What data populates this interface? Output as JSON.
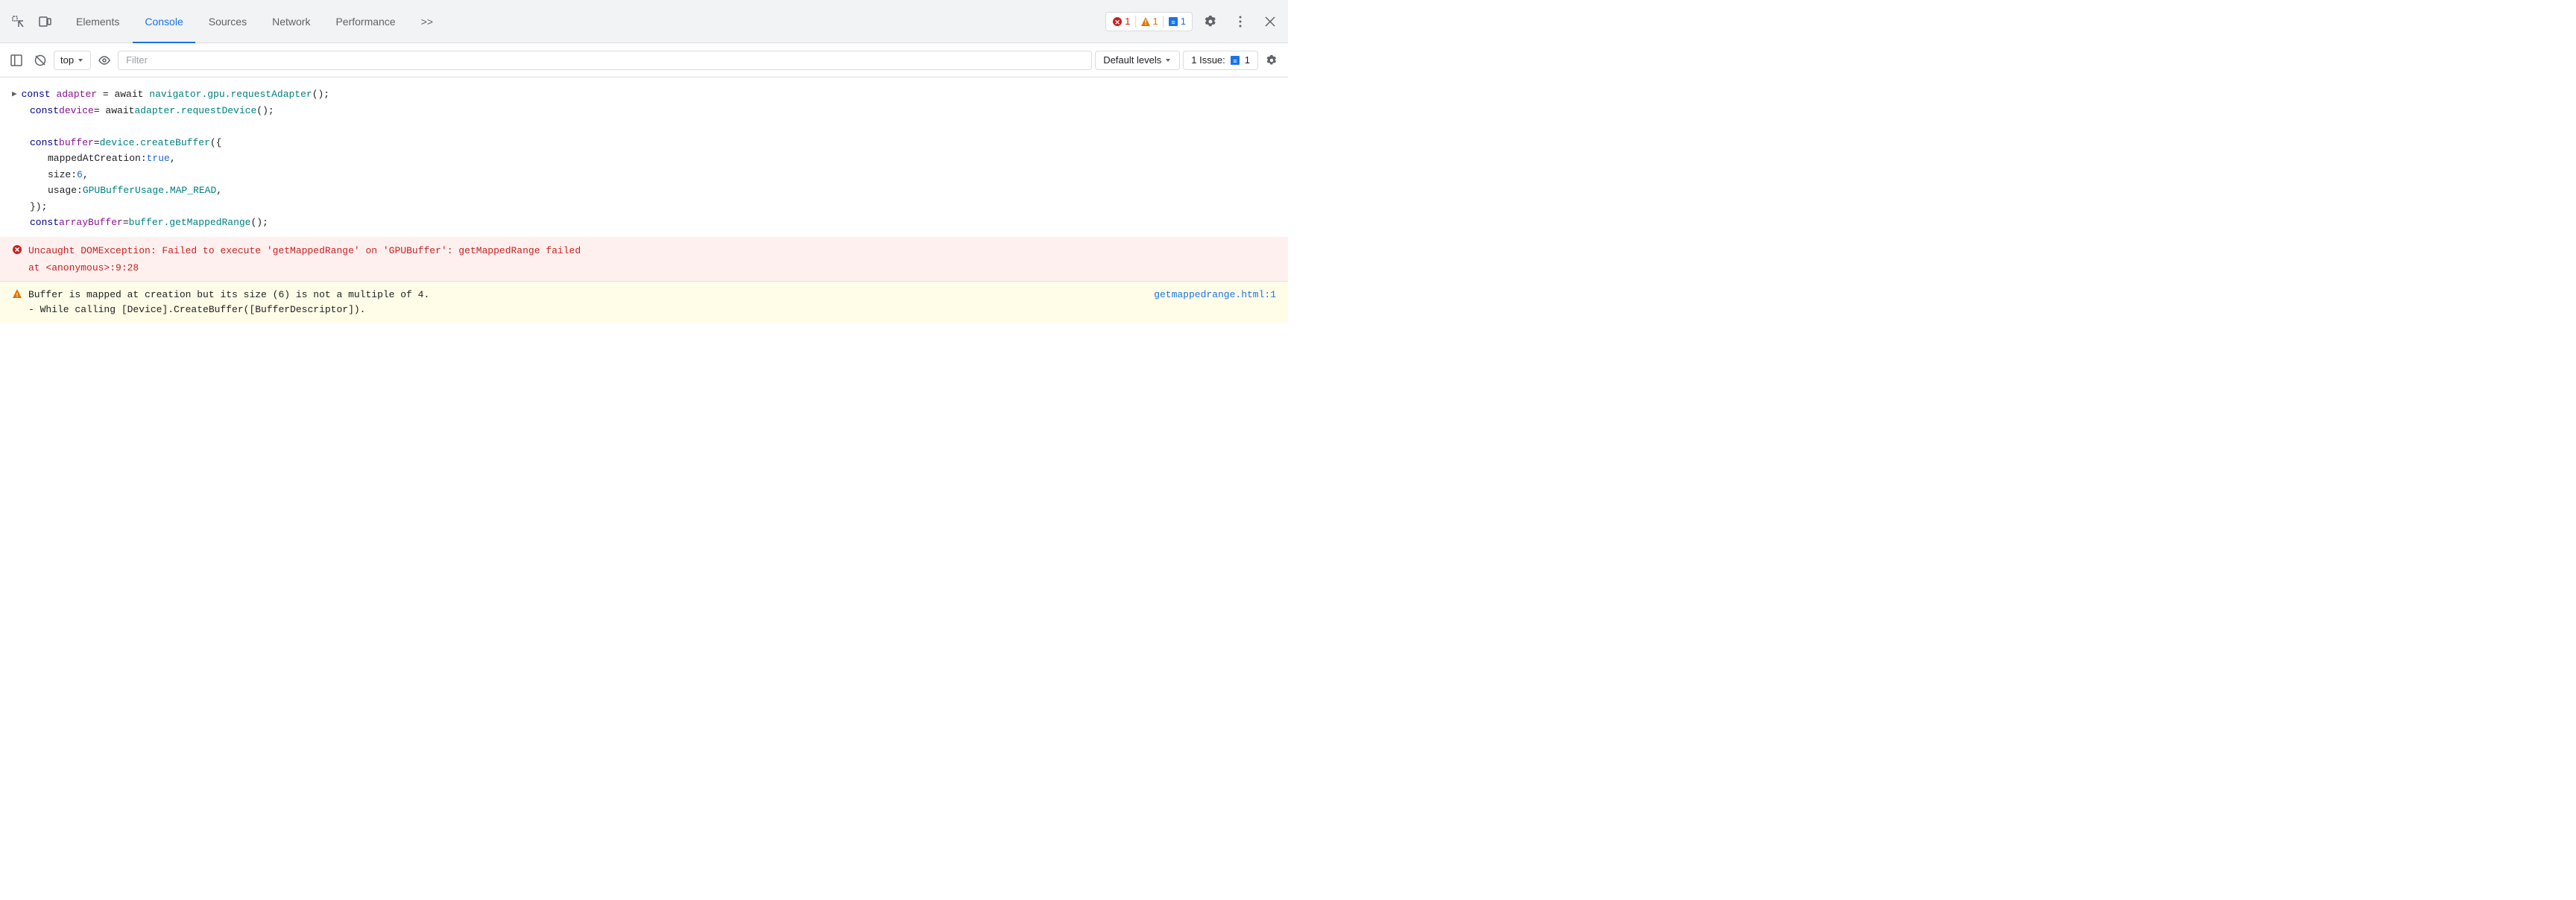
{
  "tabs": {
    "items": [
      {
        "id": "elements",
        "label": "Elements",
        "active": false
      },
      {
        "id": "console",
        "label": "Console",
        "active": true
      },
      {
        "id": "sources",
        "label": "Sources",
        "active": false
      },
      {
        "id": "network",
        "label": "Network",
        "active": false
      },
      {
        "id": "performance",
        "label": "Performance",
        "active": false
      },
      {
        "id": "more",
        "label": ">>",
        "active": false
      }
    ]
  },
  "badges": {
    "error_count": "1",
    "warning_count": "1",
    "info_count": "1"
  },
  "toolbar": {
    "context": "top",
    "filter_placeholder": "Filter",
    "levels_label": "Default levels",
    "issue_label": "1 Issue:",
    "issue_count": "1"
  },
  "code": {
    "line1_prefix": "const ",
    "line1_var": "adapter",
    "line1_eq": " = await ",
    "line1_call": "navigator.gpu.requestAdapter",
    "line1_suffix": "();",
    "line2_prefix": "const ",
    "line2_var": "device",
    "line2_eq": " = await ",
    "line2_call": "adapter.requestDevice",
    "line2_suffix": "();",
    "line3": "",
    "line4_prefix": "const ",
    "line4_var": "buffer",
    "line4_eq": " = ",
    "line4_call": "device.createBuffer",
    "line4_suffix": "({",
    "line5_key": "mappedAtCreation",
    "line5_colon": ": ",
    "line5_val": "true",
    "line5_comma": ",",
    "line6_key": "size",
    "line6_colon": ": ",
    "line6_val": "6",
    "line6_comma": ",",
    "line7_key": "usage",
    "line7_colon": ": ",
    "line7_val": "GPUBufferUsage.MAP_READ",
    "line7_comma": ",",
    "line8": "});",
    "line9_prefix": "const ",
    "line9_var": "arrayBuffer",
    "line9_eq": " = ",
    "line9_call": "buffer.getMappedRange",
    "line9_suffix": "();"
  },
  "error": {
    "message": "Uncaught DOMException: Failed to execute 'getMappedRange' on 'GPUBuffer': getMappedRange failed",
    "location": "at <anonymous>:9:28"
  },
  "warning": {
    "message": "Buffer is mapped at creation but its size (6) is not a multiple of 4.",
    "detail": "- While calling [Device].CreateBuffer([BufferDescriptor]).",
    "link": "getmappedrange.html:1"
  },
  "icons": {
    "inspect": "⋰",
    "device_toolbar": "⧉",
    "sidebar": "▶",
    "clear": "⊘",
    "eye": "◉",
    "dropdown_arrow": "▾",
    "gear": "⚙",
    "more_vert": "⋮",
    "close": "✕",
    "error_circle": "🔴",
    "warning_triangle": "⚠",
    "info_message": "💬"
  },
  "colors": {
    "active_tab": "#1a73e8",
    "error": "#c5221f",
    "warning": "#e37400",
    "info": "#1a73e8",
    "error_bg": "#fff0f0",
    "warning_bg": "#fffde7"
  }
}
